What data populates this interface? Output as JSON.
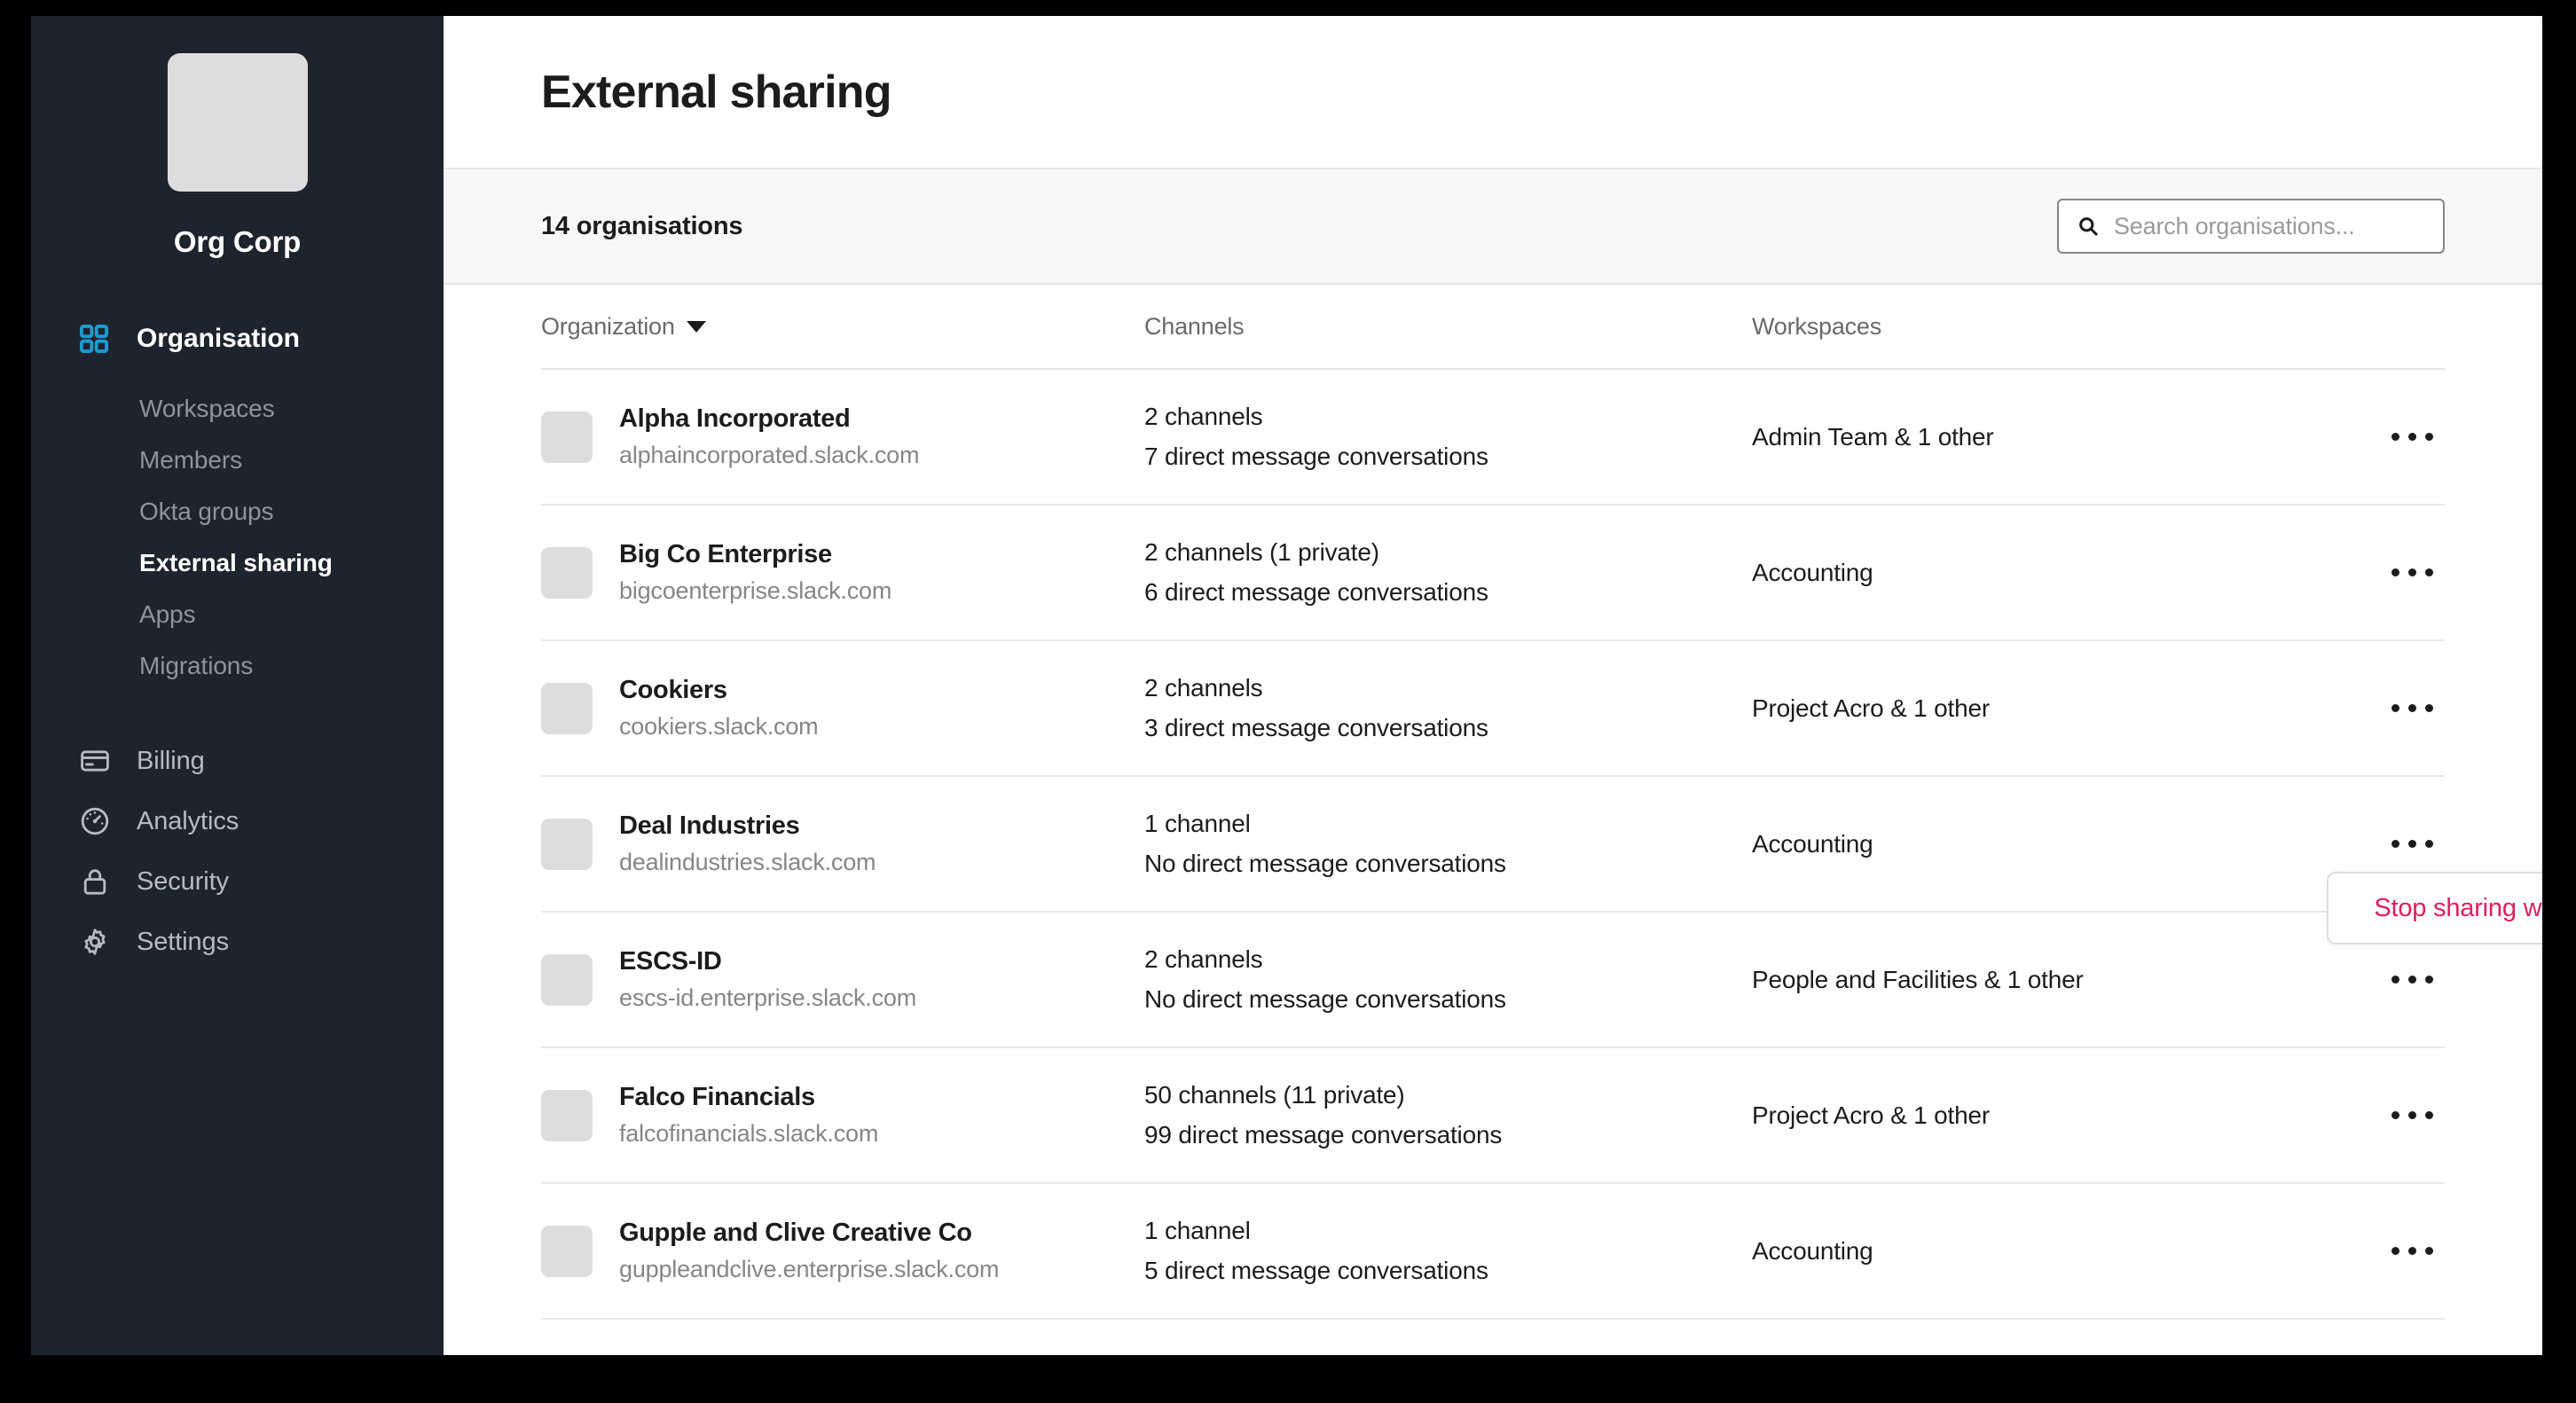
{
  "sidebar": {
    "org": {
      "logo_icon": "org-logo-placeholder",
      "name": "Org Corp"
    },
    "section": {
      "icon": "grid-icon",
      "title": "Organisation"
    },
    "sub_items": [
      {
        "label": "Workspaces",
        "active": false
      },
      {
        "label": "Members",
        "active": false
      },
      {
        "label": "Okta groups",
        "active": false
      },
      {
        "label": "External sharing",
        "active": true
      },
      {
        "label": "Apps",
        "active": false
      },
      {
        "label": "Migrations",
        "active": false
      }
    ],
    "main_items": [
      {
        "label": "Billing",
        "icon": "credit-card-icon"
      },
      {
        "label": "Analytics",
        "icon": "gauge-icon"
      },
      {
        "label": "Security",
        "icon": "lock-icon"
      },
      {
        "label": "Settings",
        "icon": "gear-icon"
      }
    ]
  },
  "header": {
    "title": "External sharing"
  },
  "toolbar": {
    "count_label": "14 organisations",
    "search": {
      "icon": "search-icon",
      "value": "",
      "placeholder": "Search organisations..."
    }
  },
  "table": {
    "columns": {
      "organization": "Organization",
      "channels": "Channels",
      "workspaces": "Workspaces"
    },
    "sort_indicator": "chevron-down-icon",
    "rows": [
      {
        "name": "Alpha Incorporated",
        "domain": "alphaincorporated.slack.com",
        "channels": "2 channels",
        "dms": "7 direct message conversations",
        "workspaces": "Admin Team & 1 other"
      },
      {
        "name": "Big Co Enterprise",
        "domain": "bigcoenterprise.slack.com",
        "channels": "2 channels (1 private)",
        "dms": "6 direct message conversations",
        "workspaces": "Accounting"
      },
      {
        "name": "Cookiers",
        "domain": "cookiers.slack.com",
        "channels": "2 channels",
        "dms": "3 direct message conversations",
        "workspaces": "Project Acro & 1 other"
      },
      {
        "name": "Deal Industries",
        "domain": "dealindustries.slack.com",
        "channels": "1 channel",
        "dms": "No direct message conversations",
        "workspaces": "Accounting"
      },
      {
        "name": "ESCS-ID",
        "domain": "escs-id.enterprise.slack.com",
        "channels": "2 channels",
        "dms": "No direct message conversations",
        "workspaces": "People and Facilities & 1 other"
      },
      {
        "name": "Falco Financials",
        "domain": "falcofinancials.slack.com",
        "channels": "50 channels (11 private)",
        "dms": "99 direct message conversations",
        "workspaces": "Project Acro & 1 other"
      },
      {
        "name": "Gupple and Clive Creative Co",
        "domain": "guppleandclive.enterprise.slack.com",
        "channels": "1 channel",
        "dms": "5 direct message conversations",
        "workspaces": "Accounting"
      }
    ]
  },
  "popover": {
    "item_label": "Stop sharing with Deal Industries"
  },
  "colors": {
    "sidebar_bg": "#1e242e",
    "accent_blue": "#1d9bd1",
    "danger": "#e01e5a",
    "text_primary": "#1d1c1d",
    "text_muted": "#868686"
  }
}
